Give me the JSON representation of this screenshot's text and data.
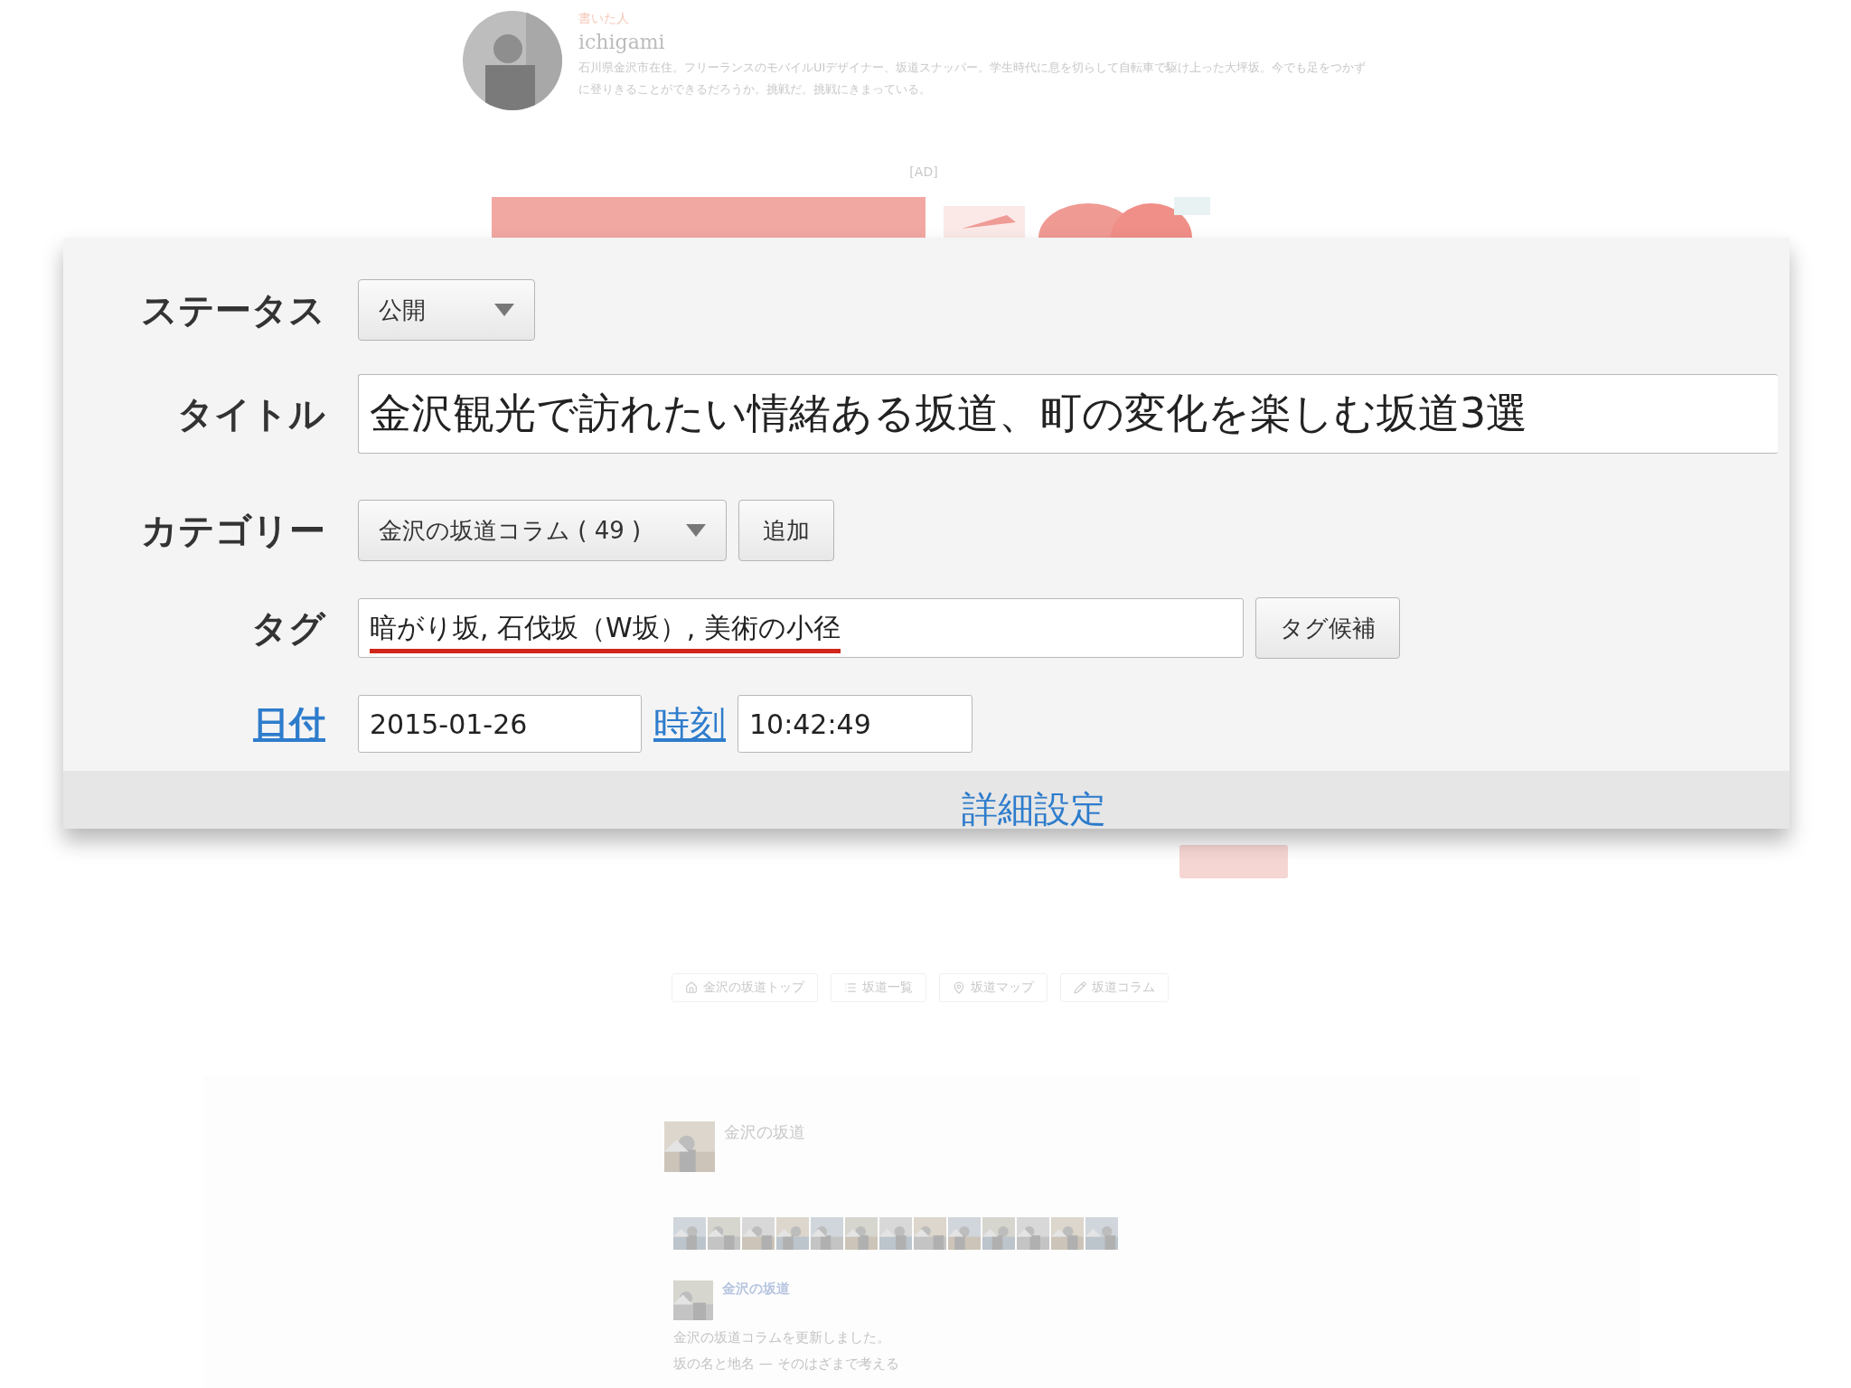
{
  "author": {
    "caption": "書いた人",
    "name": "ichigami",
    "bio": "石川県金沢市在住。フリーランスのモバイルUIデザイナー、坂道スナッパー。学生時代に息を切らして自転車で駆け上った大坪坂。今でも足をつかずに登りきることができるだろうか。挑戦だ。挑戦にきまっている。"
  },
  "ad": {
    "label": "[AD]"
  },
  "form": {
    "status": {
      "label": "ステータス",
      "value": "公開"
    },
    "title": {
      "label": "タイトル",
      "value": "金沢観光で訪れたい情緒ある坂道、町の変化を楽しむ坂道3選"
    },
    "category": {
      "label": "カテゴリー",
      "value": "金沢の坂道コラム ( 49 )",
      "button": "追加"
    },
    "tags": {
      "label": "タグ",
      "value": "暗がり坂, 石伐坂（W坂）, 美術の小径",
      "underlined": true,
      "button": "タグ候補"
    },
    "date": {
      "label": "日付",
      "value": "2015-01-26",
      "time_label": "時刻",
      "time_value": "10:42:49"
    },
    "footer_link": "詳細設定"
  },
  "nav": [
    {
      "label": "金沢の坂道トップ"
    },
    {
      "label": "坂道一覧"
    },
    {
      "label": "坂道マップ"
    },
    {
      "label": "坂道コラム"
    }
  ],
  "social": {
    "page_name": "金沢の坂道",
    "post": {
      "author": "金沢の坂道",
      "lines": [
        "金沢の坂道コラムを更新しました。",
        "坂の名と地名 — そのはざまで考える"
      ]
    }
  }
}
